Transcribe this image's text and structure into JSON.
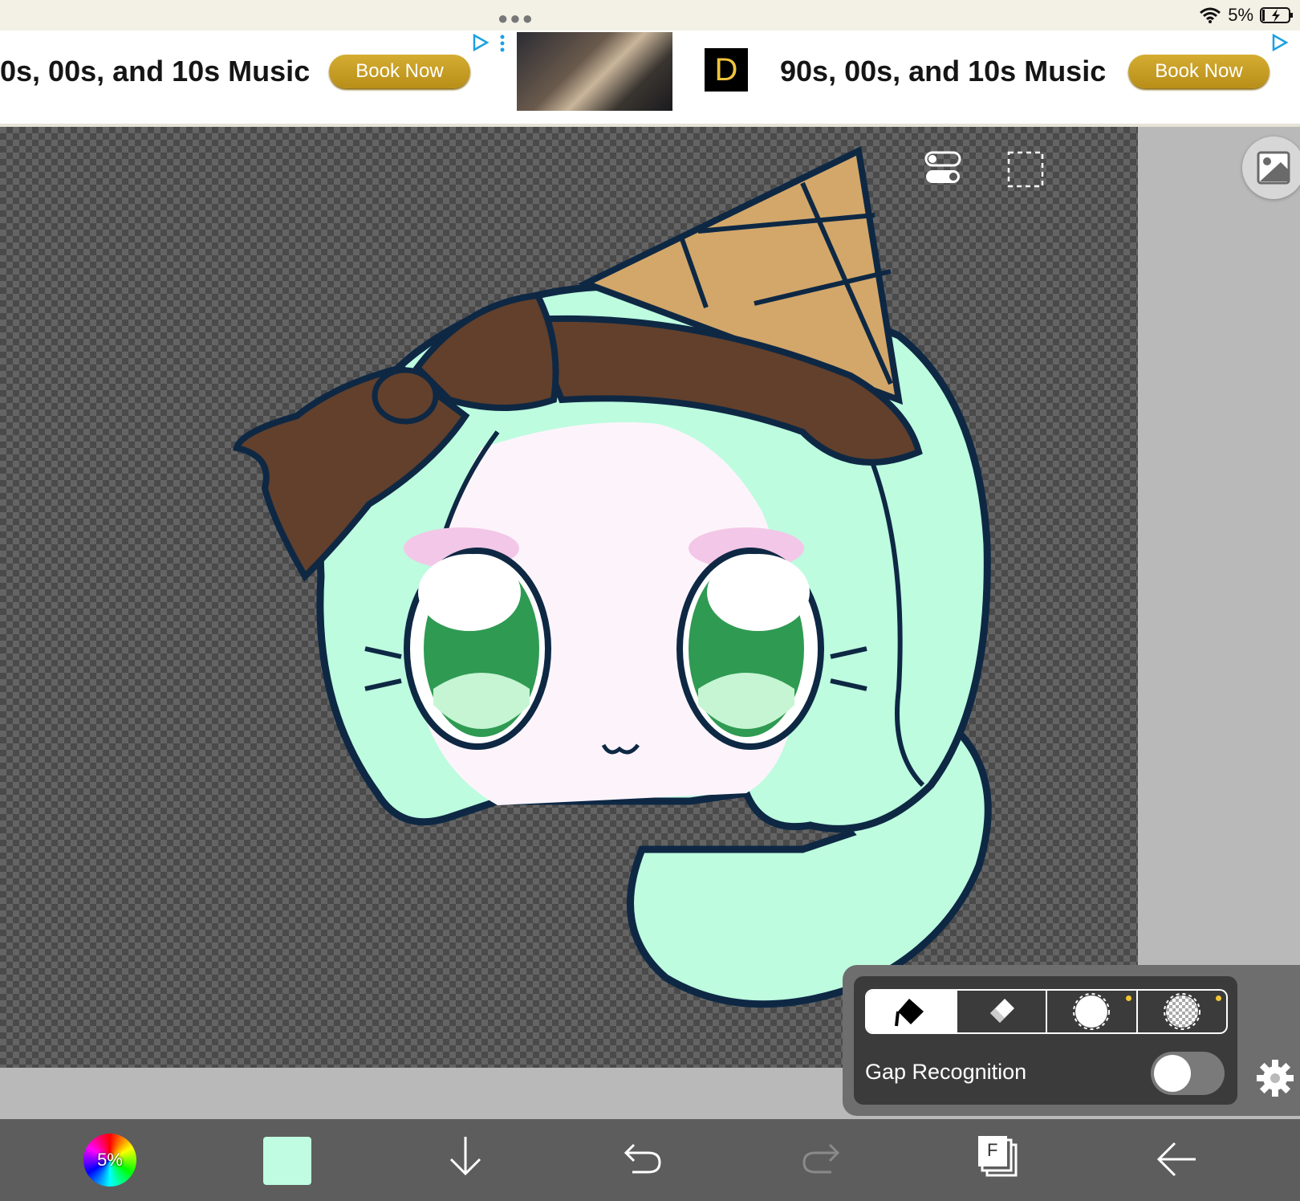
{
  "status": {
    "battery": "5%"
  },
  "ad": {
    "left_text": "0s, 00s, and 10s Music",
    "left_button": "Book Now",
    "right_text": "90s, 00s, and 10s Music",
    "right_button": "Book Now",
    "logo_letter": "D"
  },
  "fill_panel": {
    "modes": [
      "fill-bucket-icon",
      "eraser-icon",
      "circle-icon",
      "checker-icon"
    ],
    "gap_label": "Gap Recognition",
    "gap_enabled": false
  },
  "bottom_bar": {
    "color_wheel_label": "5%",
    "current_color": "#c0fce2",
    "layer_label": "F"
  },
  "colors": {
    "accent_button": "#c9a128",
    "canvas_bg": "#5a5a5a",
    "hair": "#bdfcdf",
    "bow": "#62402c",
    "cone": "#d3a76a",
    "eye": "#2f9a52",
    "outline": "#0e2844"
  }
}
